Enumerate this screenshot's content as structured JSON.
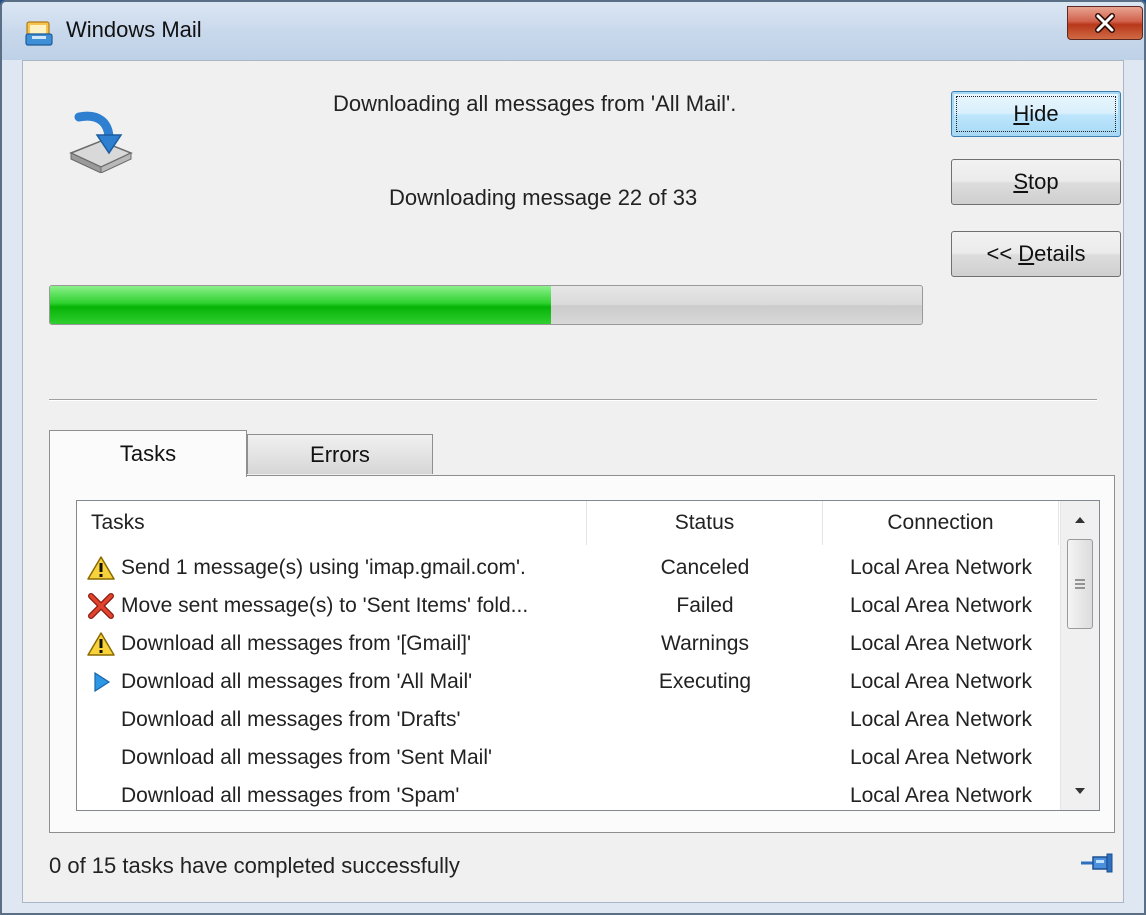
{
  "window": {
    "title": "Windows Mail"
  },
  "main": {
    "message_primary": "Downloading all messages from 'All Mail'.",
    "message_secondary": "Downloading message 22 of 33",
    "progress_fraction": 0.574
  },
  "buttons": {
    "hide": {
      "pre": "",
      "key": "H",
      "post": "ide"
    },
    "stop": {
      "pre": "",
      "key": "S",
      "post": "top"
    },
    "details": {
      "pre": "<< ",
      "key": "D",
      "post": "etails"
    }
  },
  "tabs": [
    {
      "label": "Tasks",
      "active": true
    },
    {
      "label": "Errors",
      "active": false
    }
  ],
  "table": {
    "columns": [
      "Tasks",
      "Status",
      "Connection"
    ],
    "rows": [
      {
        "icon": "warning-icon",
        "task": "Send 1 message(s) using 'imap.gmail.com'.",
        "status": "Canceled",
        "connection": "Local Area Network"
      },
      {
        "icon": "error-x-icon",
        "task": "Move sent message(s) to 'Sent Items' fold...",
        "status": "Failed",
        "connection": "Local Area Network"
      },
      {
        "icon": "warning-icon",
        "task": "Download all messages from '[Gmail]'",
        "status": "Warnings",
        "connection": "Local Area Network"
      },
      {
        "icon": "play-arrow-icon",
        "task": "Download all messages from 'All Mail'",
        "status": "Executing",
        "connection": "Local Area Network"
      },
      {
        "icon": "",
        "task": "Download all messages from 'Drafts'",
        "status": "",
        "connection": "Local Area Network"
      },
      {
        "icon": "",
        "task": "Download all messages from 'Sent Mail'",
        "status": "",
        "connection": "Local Area Network"
      },
      {
        "icon": "",
        "task": "Download all messages from 'Spam'",
        "status": "",
        "connection": "Local Area Network"
      }
    ]
  },
  "footer": {
    "status_text": "0 of 15 tasks have completed successfully"
  },
  "colors": {
    "progress_green": "#07b307",
    "close_red": "#c5432a",
    "focus_blue": "#3c7fb1"
  }
}
